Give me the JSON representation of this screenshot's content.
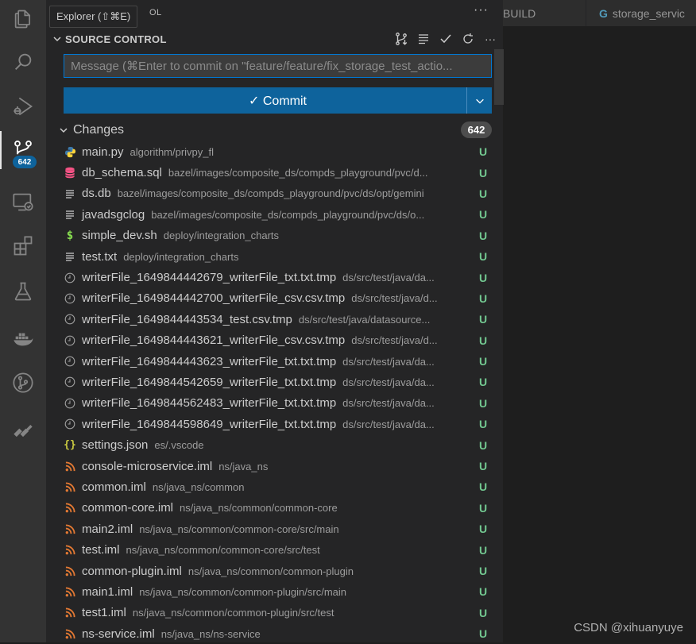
{
  "tooltip": "Explorer (⇧⌘E)",
  "sidebar_header_fragment": "OL",
  "activity": {
    "badge": "642"
  },
  "tabs": [
    {
      "label": "BUILD"
    },
    {
      "label": "storage_servic"
    }
  ],
  "section": {
    "title": "SOURCE CONTROL"
  },
  "commit": {
    "placeholder": "Message (⌘Enter to commit on \"feature/feature/fix_storage_test_actio...",
    "button_label": "✓ Commit"
  },
  "changes": {
    "label": "Changes",
    "count": "642"
  },
  "files": [
    {
      "name": "main.py",
      "path": "algorithm/privpy_fl",
      "status": "U",
      "icon": "python-icon"
    },
    {
      "name": "db_schema.sql",
      "path": "bazel/images/composite_ds/compds_playground/pvc/d...",
      "status": "U",
      "icon": "database-icon"
    },
    {
      "name": "ds.db",
      "path": "bazel/images/composite_ds/compds_playground/pvc/ds/opt/gemini",
      "status": "U",
      "icon": "text-file-icon"
    },
    {
      "name": "javadsgclog",
      "path": "bazel/images/composite_ds/compds_playground/pvc/ds/o...",
      "status": "U",
      "icon": "text-file-icon"
    },
    {
      "name": "simple_dev.sh",
      "path": "deploy/integration_charts",
      "status": "U",
      "icon": "shell-icon"
    },
    {
      "name": "test.txt",
      "path": "deploy/integration_charts",
      "status": "U",
      "icon": "text-file-icon"
    },
    {
      "name": "writerFile_1649844442679_writerFile_txt.txt.tmp",
      "path": "ds/src/test/java/da...",
      "status": "U",
      "icon": "clock-icon"
    },
    {
      "name": "writerFile_1649844442700_writerFile_csv.csv.tmp",
      "path": "ds/src/test/java/d...",
      "status": "U",
      "icon": "clock-icon"
    },
    {
      "name": "writerFile_1649844443534_test.csv.tmp",
      "path": "ds/src/test/java/datasource...",
      "status": "U",
      "icon": "clock-icon"
    },
    {
      "name": "writerFile_1649844443621_writerFile_csv.csv.tmp",
      "path": "ds/src/test/java/d...",
      "status": "U",
      "icon": "clock-icon"
    },
    {
      "name": "writerFile_1649844443623_writerFile_txt.txt.tmp",
      "path": "ds/src/test/java/da...",
      "status": "U",
      "icon": "clock-icon"
    },
    {
      "name": "writerFile_1649844542659_writerFile_txt.txt.tmp",
      "path": "ds/src/test/java/da...",
      "status": "U",
      "icon": "clock-icon"
    },
    {
      "name": "writerFile_1649844562483_writerFile_txt.txt.tmp",
      "path": "ds/src/test/java/da...",
      "status": "U",
      "icon": "clock-icon"
    },
    {
      "name": "writerFile_1649844598649_writerFile_txt.txt.tmp",
      "path": "ds/src/test/java/da...",
      "status": "U",
      "icon": "clock-icon"
    },
    {
      "name": "settings.json",
      "path": "es/.vscode",
      "status": "U",
      "icon": "json-icon"
    },
    {
      "name": "console-microservice.iml",
      "path": "ns/java_ns",
      "status": "U",
      "icon": "rss-icon"
    },
    {
      "name": "common.iml",
      "path": "ns/java_ns/common",
      "status": "U",
      "icon": "rss-icon"
    },
    {
      "name": "common-core.iml",
      "path": "ns/java_ns/common/common-core",
      "status": "U",
      "icon": "rss-icon"
    },
    {
      "name": "main2.iml",
      "path": "ns/java_ns/common/common-core/src/main",
      "status": "U",
      "icon": "rss-icon"
    },
    {
      "name": "test.iml",
      "path": "ns/java_ns/common/common-core/src/test",
      "status": "U",
      "icon": "rss-icon"
    },
    {
      "name": "common-plugin.iml",
      "path": "ns/java_ns/common/common-plugin",
      "status": "U",
      "icon": "rss-icon"
    },
    {
      "name": "main1.iml",
      "path": "ns/java_ns/common/common-plugin/src/main",
      "status": "U",
      "icon": "rss-icon"
    },
    {
      "name": "test1.iml",
      "path": "ns/java_ns/common/common-plugin/src/test",
      "status": "U",
      "icon": "rss-icon"
    },
    {
      "name": "ns-service.iml",
      "path": "ns/java_ns/ns-service",
      "status": "U",
      "icon": "rss-icon"
    }
  ],
  "colors": {
    "status_untracked": "#73c991",
    "accent": "#0e639c",
    "focus_border": "#0078d4"
  },
  "watermark": "CSDN @xihuanyuye"
}
